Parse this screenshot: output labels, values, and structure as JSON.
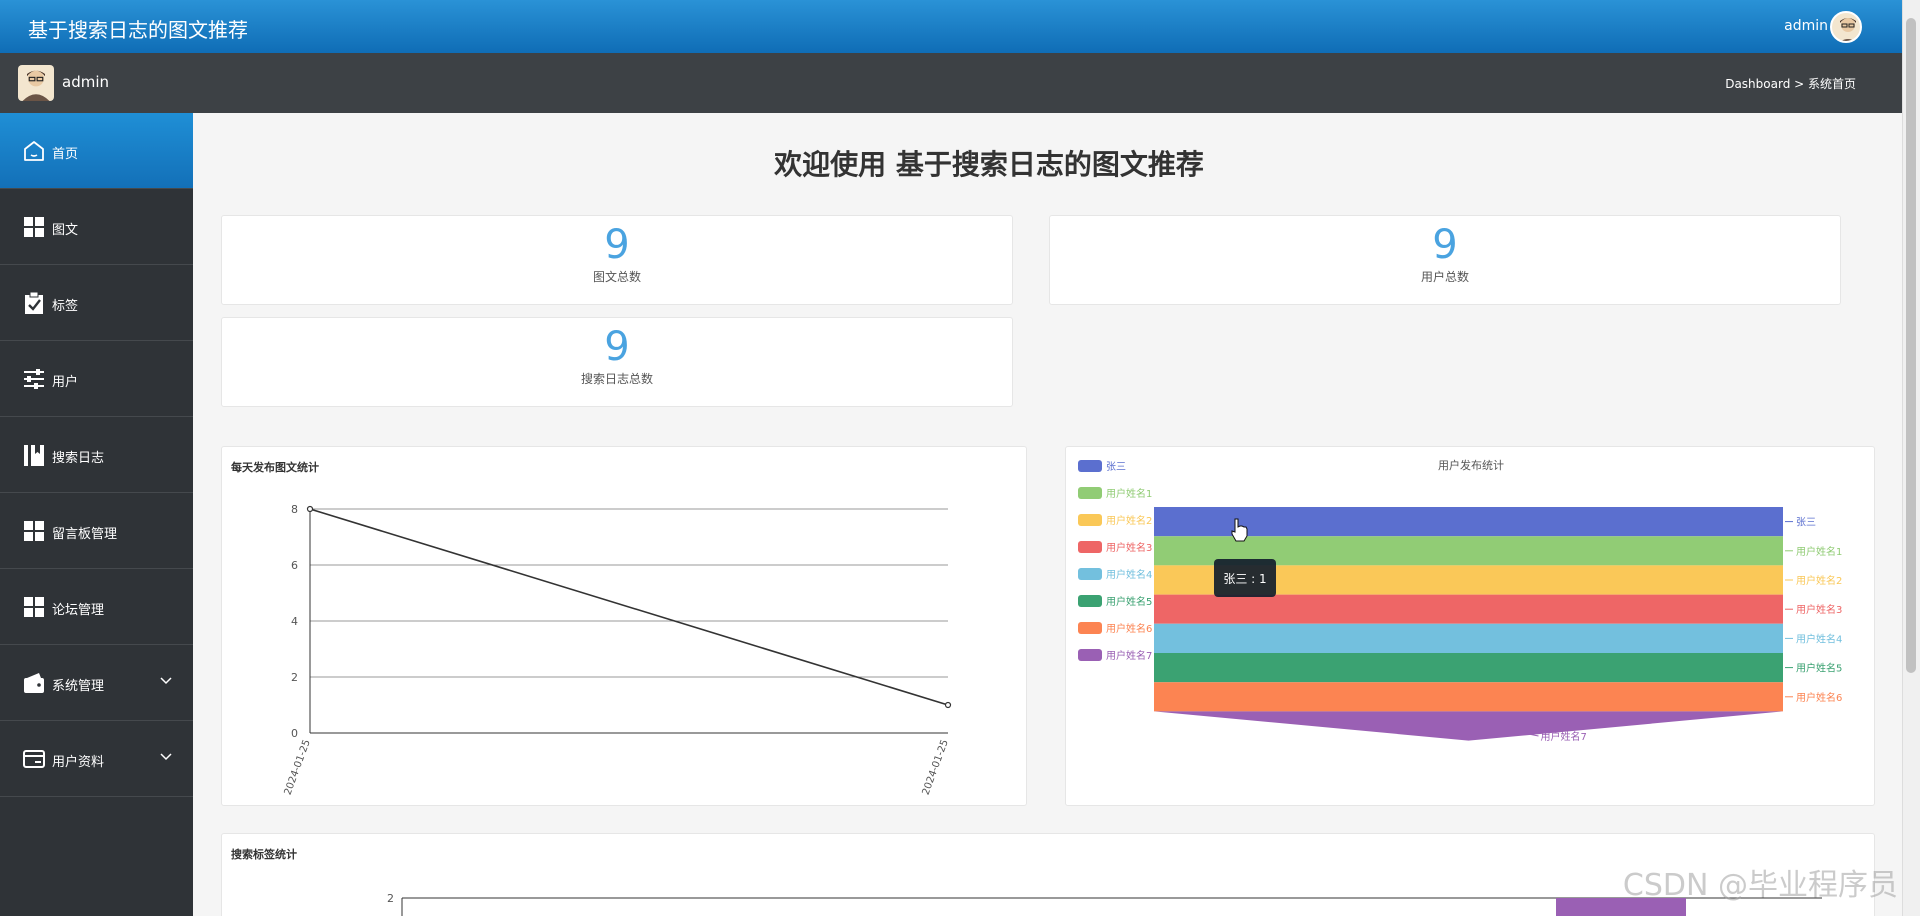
{
  "header": {
    "title": "基于搜索日志的图文推荐",
    "user": "admin"
  },
  "userbar": {
    "name": "admin",
    "breadcrumb": "Dashboard > 系统首页"
  },
  "sidebar": {
    "items": [
      {
        "label": "首页",
        "icon": "home-icon",
        "active": true
      },
      {
        "label": "图文",
        "icon": "grid-icon"
      },
      {
        "label": "标签",
        "icon": "clipboard-check-icon"
      },
      {
        "label": "用户",
        "icon": "sliders-icon"
      },
      {
        "label": "搜索日志",
        "icon": "book-icon"
      },
      {
        "label": "留言板管理",
        "icon": "grid-icon"
      },
      {
        "label": "论坛管理",
        "icon": "grid-icon"
      },
      {
        "label": "系统管理",
        "icon": "wallet-icon",
        "expandable": true
      },
      {
        "label": "用户资料",
        "icon": "card-icon",
        "expandable": true
      }
    ]
  },
  "main": {
    "welcome": "欢迎使用 基于搜索日志的图文推荐",
    "stats": [
      {
        "value": "9",
        "label": "图文总数"
      },
      {
        "value": "9",
        "label": "用户总数"
      },
      {
        "value": "9",
        "label": "搜索日志总数"
      }
    ]
  },
  "chart_data": [
    {
      "type": "line",
      "title": "每天发布图文统计",
      "x": [
        "2024-01-25",
        "2024-01-25"
      ],
      "values": [
        8,
        1
      ],
      "ylim": [
        0,
        8
      ],
      "yticks": [
        0,
        2,
        4,
        6,
        8
      ],
      "grid": true,
      "color": "#333333"
    },
    {
      "type": "funnel",
      "title": "用户发布统计",
      "legend_position": "top-left",
      "categories": [
        "张三",
        "用户姓名1",
        "用户姓名2",
        "用户姓名3",
        "用户姓名4",
        "用户姓名5",
        "用户姓名6",
        "用户姓名7"
      ],
      "values": [
        1,
        1,
        1,
        1,
        1,
        1,
        1,
        1
      ],
      "colors": [
        "#5b6fcf",
        "#91cc75",
        "#fac858",
        "#ee6666",
        "#73c0de",
        "#3ba272",
        "#fc8452",
        "#9a60b4"
      ],
      "tooltip": "张三 : 1"
    },
    {
      "type": "bar",
      "title": "搜索标签统计",
      "ytick_top": "2",
      "bar_color": "#9a60b4"
    }
  ],
  "watermark": "CSDN @毕业程序员"
}
